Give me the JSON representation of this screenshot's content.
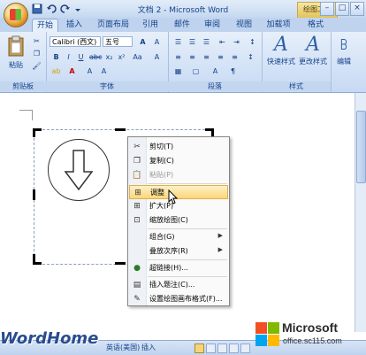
{
  "window": {
    "title": "文档 2 - Microsoft Word",
    "contextual_tab_group": "绘图工具",
    "controls": [
      "–",
      "□",
      "×"
    ]
  },
  "tabs": [
    "开始",
    "插入",
    "页面布局",
    "引用",
    "邮件",
    "审阅",
    "视图",
    "加载项",
    "格式"
  ],
  "ribbon": {
    "clipboard": {
      "paste_label": "粘贴",
      "group_label": "剪贴板"
    },
    "font": {
      "font_name": "Calibri (西文)",
      "font_size": "五号",
      "group_label": "字体"
    },
    "paragraph": {
      "group_label": "段落"
    },
    "styles": {
      "quick_styles_label": "快速样式",
      "change_styles_label": "更改样式",
      "group_label": "样式"
    },
    "editing": {
      "label": "编辑"
    }
  },
  "context_menu": {
    "items": [
      {
        "label": "剪切(T)",
        "icon": "cut-icon"
      },
      {
        "label": "复制(C)",
        "icon": "copy-icon"
      },
      {
        "label": "粘贴(P)",
        "icon": "paste-icon",
        "disabled": true
      },
      {
        "label": "调整",
        "icon": "fit-icon",
        "highlighted": true
      },
      {
        "label": "扩大(P)",
        "icon": "expand-icon"
      },
      {
        "label": "缩放绘图(C)",
        "icon": "scale-drawing-icon"
      },
      {
        "label": "组合(G)",
        "submenu": true
      },
      {
        "label": "叠放次序(R)",
        "submenu": true
      },
      {
        "label": "超链接(H)...",
        "icon": "hyperlink-icon"
      },
      {
        "label": "插入题注(C)...",
        "icon": "caption-icon"
      },
      {
        "label": "设置绘图画布格式(F)...",
        "icon": "format-canvas-icon"
      }
    ]
  },
  "statusbar": {
    "language": "英语(美国)",
    "mode": "插入"
  },
  "watermarks": {
    "wordhome": "WordHome",
    "microsoft": "Microsoft",
    "site": "office.sc115.com"
  },
  "colors": {
    "ribbon_accent": "#15428b",
    "menu_highlight": "#fbd67a"
  }
}
